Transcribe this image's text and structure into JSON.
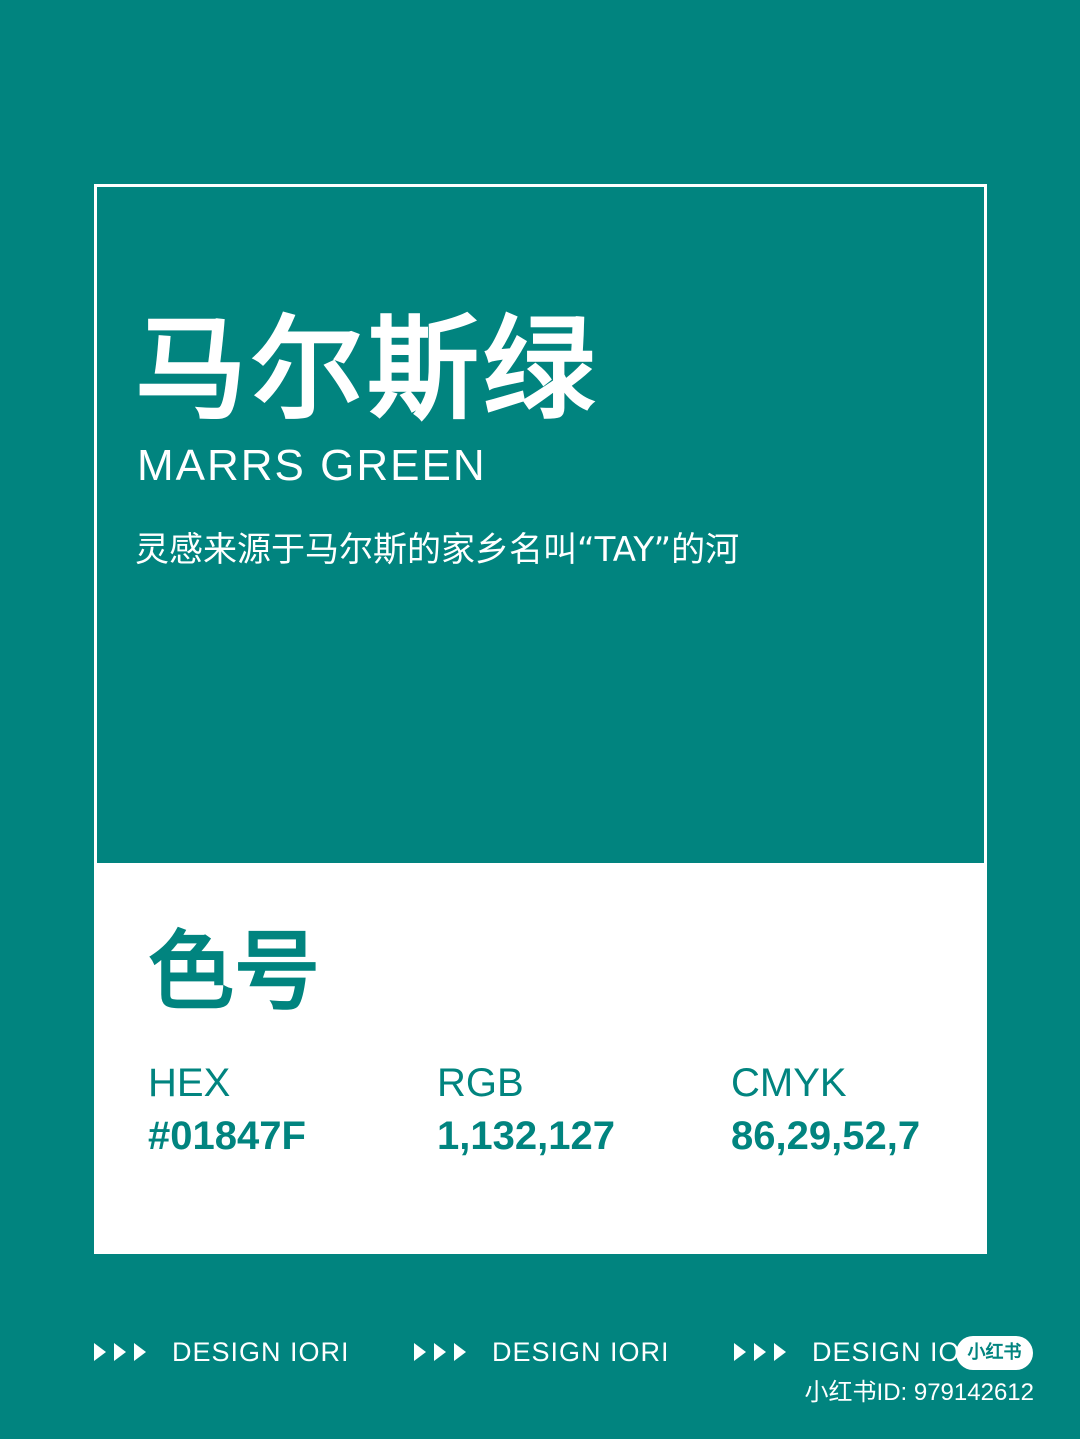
{
  "colors": {
    "background": "#01847F",
    "card_bottom": "#ffffff",
    "text_light": "#ffffff",
    "text_accent": "#01847F"
  },
  "header": {
    "title_cn": "马尔斯绿",
    "title_en": "MARRS GREEN",
    "description": "灵感来源于马尔斯的家乡名叫“TAY”的河"
  },
  "codes": {
    "section_title": "色号",
    "items": [
      {
        "label": "HEX",
        "value": "#01847F"
      },
      {
        "label": "RGB",
        "value": "1,132,127"
      },
      {
        "label": "CMYK",
        "value": "86,29,52,7"
      }
    ]
  },
  "footer": {
    "items": [
      {
        "text": "DESIGN IORI",
        "icon": "triple-arrow-icon"
      },
      {
        "text": "DESIGN IORI",
        "icon": "triple-arrow-icon"
      },
      {
        "text": "DESIGN IORI",
        "icon": "triple-arrow-icon"
      }
    ]
  },
  "watermark": {
    "badge": "小红书",
    "id_text": "小红书ID: 979142612"
  }
}
